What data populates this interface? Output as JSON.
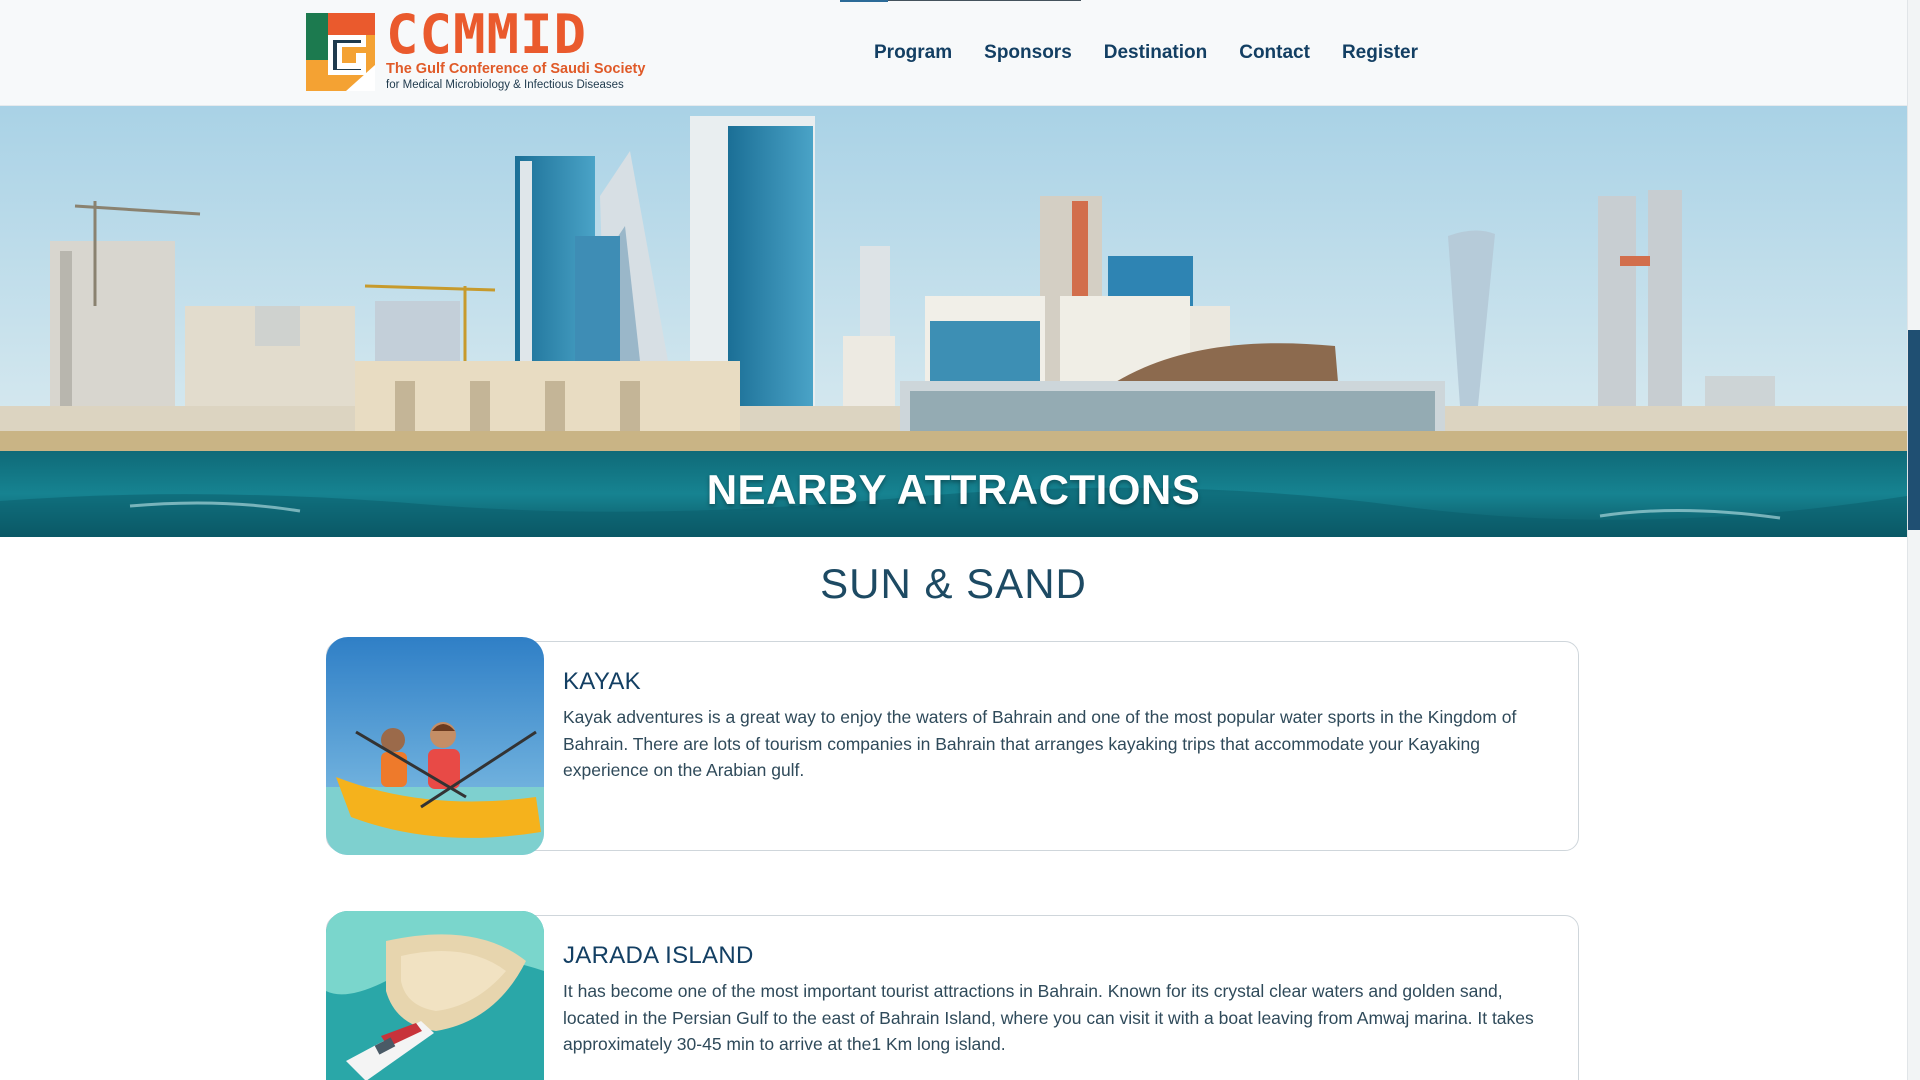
{
  "logo": {
    "wordmark": "CCMMID",
    "line1": "The Gulf Conference of Saudi Society",
    "line2": "for Medical Microbiology & Infectious Diseases",
    "colors": {
      "orange": "#ea5a2d",
      "green": "#1c7a4f",
      "amber": "#f4a233",
      "navy": "#1f3a4d"
    }
  },
  "nav": {
    "items": [
      "Program",
      "Sponsors",
      "Destination",
      "Contact",
      "Register"
    ]
  },
  "hero": {
    "title": "NEARBY ATTRACTIONS"
  },
  "section": {
    "title": "SUN & SAND"
  },
  "cards": [
    {
      "title": "KAYAK",
      "text": "Kayak adventures is a great way to enjoy the waters of Bahrain and one of the most popular water sports in the Kingdom of Bahrain. There are lots of tourism companies in Bahrain that arranges kayaking trips that accommodate your Kayaking experience on the Arabian gulf.",
      "image": "kayak-photo"
    },
    {
      "title": "JARADA ISLAND",
      "text": "It has become one of the most important tourist attractions in Bahrain. Known for its crystal clear waters and golden sand, located in the Persian Gulf to the east of Bahrain Island, where you can visit it with a boat leaving from Amwaj marina. It takes approximately 30-45 min to arrive at the1 Km long island.",
      "image": "island-photo"
    }
  ],
  "theme": {
    "accent": "#133f63",
    "header_bg": "#f7f9fa",
    "card_border": "#cfd6db"
  }
}
